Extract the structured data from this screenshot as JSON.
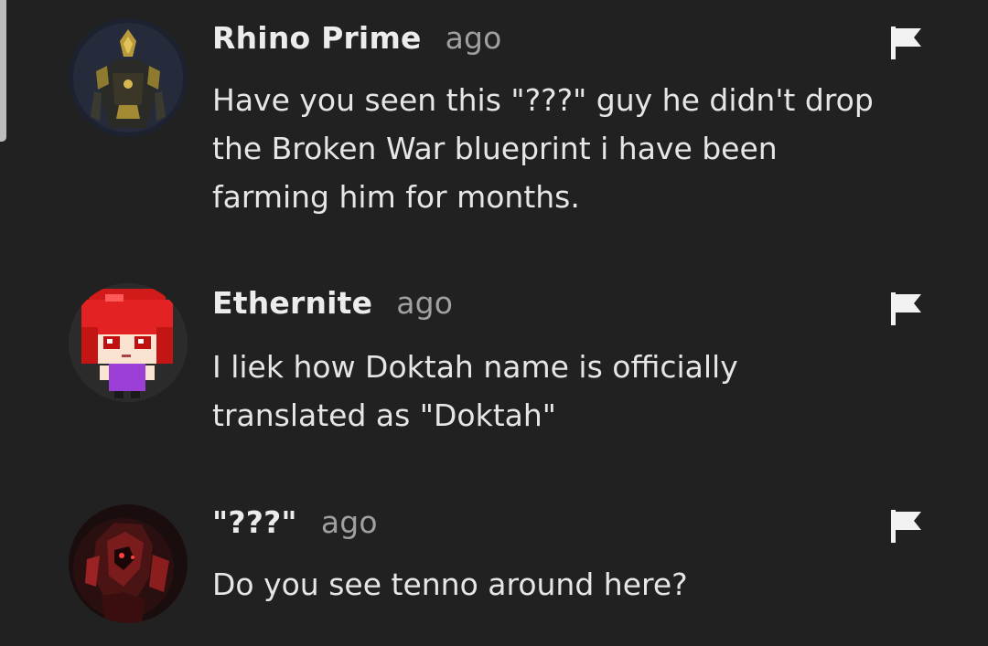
{
  "comments": [
    {
      "username": "Rhino Prime",
      "time": "ago",
      "avatar_icon": "armored-warrior-avatar",
      "lines": [
        "Have you seen this \"???\" guy he didn't drop",
        "the Broken War blueprint i have been",
        "farming him for months."
      ],
      "flag_icon": "flag-icon"
    },
    {
      "username": "Ethernite",
      "time": "ago",
      "avatar_icon": "pixel-redhead-avatar",
      "lines": [
        "I liek how Doktah name is officially",
        "translated as \"Doktah\""
      ],
      "flag_icon": "flag-icon"
    },
    {
      "username": "\"???\"",
      "time": "ago",
      "avatar_icon": "dark-red-figure-avatar",
      "lines": [
        "Do you see tenno around here?"
      ],
      "flag_icon": "flag-icon"
    }
  ],
  "colors": {
    "background": "#212121",
    "username": "#ececec",
    "time": "#a0a0a0",
    "text": "#e6e6e6",
    "flag": "#f2f2f2"
  }
}
